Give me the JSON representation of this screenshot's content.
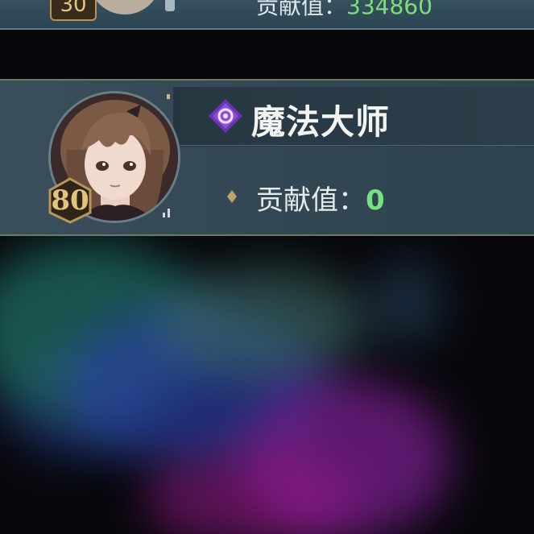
{
  "top_card": {
    "level": "30",
    "contribution_label": "贡献值：",
    "contribution_value": "334860"
  },
  "member_card": {
    "level": "80",
    "title": "魔法大师",
    "contribution_label": "贡献值：",
    "contribution_value": "0",
    "rank_icon": "purple-diamond-eye-icon",
    "bullet_icon": "gold-diamond-icon"
  },
  "colors": {
    "contribution_value": "#76e283",
    "level_gold": "#e2c27c",
    "rank_purple": "#7b3fc4"
  }
}
